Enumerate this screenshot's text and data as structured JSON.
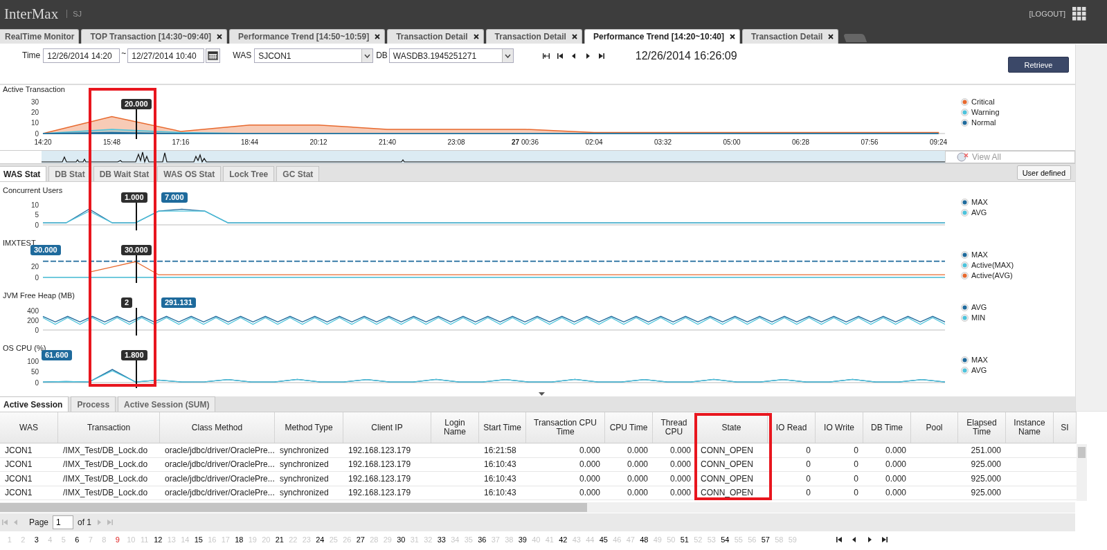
{
  "header": {
    "logo": "InterMax",
    "user": "SJ",
    "logout": "[LOGOUT]"
  },
  "tabs": [
    {
      "label": "RealTime Monitor",
      "selected": false,
      "closable": false
    },
    {
      "label": "TOP Transaction [14:30~09:40]",
      "selected": false,
      "closable": true
    },
    {
      "label": "Performance Trend [14:50~10:59]",
      "selected": false,
      "closable": true
    },
    {
      "label": "Transaction Detail",
      "selected": false,
      "closable": true
    },
    {
      "label": "Transaction Detail",
      "selected": false,
      "closable": true
    },
    {
      "label": "Performance Trend [14:20~10:40]",
      "selected": true,
      "closable": true
    },
    {
      "label": "Transaction Detail",
      "selected": false,
      "closable": true
    }
  ],
  "filter": {
    "time_label": "Time",
    "from": "12/26/2014 14:20",
    "separator": "~",
    "to": "12/27/2014 10:40",
    "was_label": "WAS",
    "was": "SJCON1",
    "db_label": "DB",
    "db": "WASDB3.1945251271",
    "current_time": "12/26/2014 16:26:09",
    "retrieve": "Retrieve"
  },
  "active_transaction": {
    "title": "Active Transaction",
    "tooltips": [
      {
        "text": "20.000",
        "kind": "cursor"
      }
    ],
    "chart_data": {
      "type": "area",
      "legend": "right",
      "ylim": [
        0,
        30
      ],
      "yticks": [
        0,
        10,
        20,
        30
      ],
      "categories": [
        "14:20",
        "15:48",
        "17:16",
        "18:44",
        "20:12",
        "21:40",
        "23:08",
        "**27** 00:36",
        "02:04",
        "03:32",
        "05:00",
        "06:28",
        "07:56",
        "09:24"
      ],
      "series": [
        {
          "name": "Critical",
          "color": "#e8692e",
          "values": [
            0,
            16,
            2,
            8,
            8,
            4,
            4,
            4,
            1,
            1,
            1,
            1,
            1,
            1
          ]
        },
        {
          "name": "Warning",
          "color": "#4cc3dc",
          "values": [
            0,
            4,
            1,
            0,
            0,
            0,
            0,
            0,
            0,
            0,
            0,
            0,
            0,
            0
          ]
        },
        {
          "name": "Normal",
          "color": "#1e6a9c",
          "values": [
            0,
            1,
            0,
            0,
            0,
            0,
            0,
            0,
            0,
            0,
            0,
            0,
            0,
            0
          ]
        }
      ]
    },
    "view_all": "View All"
  },
  "stat_tabs": [
    {
      "label": "WAS Stat",
      "selected": true
    },
    {
      "label": "DB Stat",
      "selected": false
    },
    {
      "label": "DB Wait Stat",
      "selected": false
    },
    {
      "label": "WAS OS Stat",
      "selected": false
    },
    {
      "label": "Lock Tree",
      "selected": false
    },
    {
      "label": "GC Stat",
      "selected": false
    }
  ],
  "user_defined": "User defined",
  "highlight_cursor": true,
  "charts": [
    {
      "title": "Concurrent Users",
      "tooltips": [
        {
          "text": "1.000",
          "kind": "cursor"
        },
        {
          "text": "7.000",
          "kind": "after"
        }
      ],
      "chart_data": {
        "type": "line",
        "legend": "right",
        "ylim": [
          0,
          12
        ],
        "yticks": [
          0,
          5,
          10
        ],
        "series": [
          {
            "name": "MAX",
            "color": "#1e6a9c",
            "values": [
              1,
              1,
              8,
              1,
              1,
              7,
              8,
              7,
              1,
              1,
              1,
              1,
              1,
              1,
              1,
              1,
              1,
              1,
              1,
              1,
              1,
              1,
              1,
              1,
              1,
              1,
              1,
              1,
              1,
              1,
              1,
              1,
              1,
              1,
              1,
              1,
              1,
              1,
              1,
              1
            ]
          },
          {
            "name": "AVG",
            "color": "#4cc3dc",
            "values": [
              1,
              1,
              7,
              1,
              1,
              7,
              7,
              7,
              1,
              1,
              1,
              1,
              1,
              1,
              1,
              1,
              1,
              1,
              1,
              1,
              1,
              1,
              1,
              1,
              1,
              1,
              1,
              1,
              1,
              1,
              1,
              1,
              1,
              1,
              1,
              1,
              1,
              1,
              1,
              1
            ]
          }
        ]
      }
    },
    {
      "title": "IMXTEST",
      "tooltips": [
        {
          "text": "30.000",
          "kind": "start"
        },
        {
          "text": "30.000",
          "kind": "cursor"
        }
      ],
      "chart_data": {
        "type": "line",
        "legend": "right",
        "ylim": [
          0,
          45
        ],
        "yticks": [
          0,
          20
        ],
        "series": [
          {
            "name": "MAX",
            "color": "#1e6a9c",
            "line_style": "dashed",
            "values": [
              31,
              31,
              31,
              31,
              31,
              31,
              31,
              31,
              31,
              31,
              31,
              31,
              31,
              31,
              31,
              31,
              31,
              31,
              31,
              31,
              31,
              31,
              31,
              31,
              31,
              31,
              31,
              31,
              31,
              31,
              31,
              31,
              31,
              31,
              31,
              31,
              31,
              31,
              31,
              31
            ]
          },
          {
            "name": "Active(MAX)",
            "color": "#4cc3dc",
            "values": [
              0,
              0,
              0,
              0,
              0,
              0,
              0,
              0,
              0,
              0,
              0,
              0,
              0,
              0,
              0,
              0,
              0,
              0,
              0,
              0,
              0,
              0,
              0,
              0,
              0,
              0,
              0,
              0,
              0,
              0,
              0,
              0,
              0,
              0,
              0,
              0,
              0,
              0,
              0,
              0
            ]
          },
          {
            "name": "Active(AVG)",
            "color": "#e8692e",
            "values": [
              null,
              null,
              10,
              20,
              30,
              5,
              5,
              5,
              5,
              5,
              5,
              5,
              5,
              5,
              5,
              5,
              5,
              5,
              5,
              5,
              5,
              5,
              5,
              5,
              5,
              5,
              5,
              5,
              5,
              5,
              5,
              5,
              5,
              5,
              5,
              5,
              5,
              5,
              5,
              5
            ]
          }
        ]
      }
    },
    {
      "title": "JVM Free Heap (MB)",
      "tooltips": [
        {
          "text": "2",
          "kind": "cursor"
        },
        {
          "text": "291.131",
          "kind": "after"
        }
      ],
      "chart_data": {
        "type": "line",
        "legend": "right",
        "ylim": [
          0,
          500
        ],
        "yticks": [
          0,
          200,
          400
        ],
        "series": [
          {
            "name": "AVG",
            "color": "#1e6a9c",
            "values": [
              290,
              170,
              290,
              170,
              290,
              170,
              290,
              170,
              290,
              170,
              290,
              170,
              290,
              170,
              290,
              170,
              290,
              170,
              290,
              170,
              290,
              170,
              290,
              170,
              290,
              170,
              290,
              170,
              290,
              170,
              290,
              170,
              290,
              170,
              290,
              170,
              290,
              170,
              290,
              170,
              290,
              170,
              290,
              170,
              290,
              170,
              290,
              170,
              290,
              170,
              290,
              170,
              290,
              170,
              290,
              170,
              290,
              170,
              290,
              170,
              290,
              170,
              290,
              170,
              290,
              170,
              290,
              170,
              290,
              170,
              290,
              170,
              290,
              170
            ]
          },
          {
            "name": "MIN",
            "color": "#4cc3dc",
            "values": [
              260,
              120,
              260,
              120,
              260,
              120,
              260,
              120,
              260,
              120,
              260,
              120,
              260,
              120,
              260,
              120,
              260,
              120,
              260,
              120,
              260,
              120,
              260,
              120,
              260,
              120,
              260,
              120,
              260,
              120,
              260,
              120,
              260,
              120,
              260,
              120,
              260,
              120,
              260,
              120,
              260,
              120,
              260,
              120,
              260,
              120,
              260,
              120,
              260,
              120,
              260,
              120,
              260,
              120,
              260,
              120,
              260,
              120,
              260,
              120,
              260,
              120,
              260,
              120,
              260,
              120,
              260,
              120,
              260,
              120,
              260,
              120,
              260,
              120
            ]
          }
        ]
      }
    },
    {
      "title": "OS CPU (%)",
      "tooltips": [
        {
          "text": "61.600",
          "kind": "before"
        },
        {
          "text": "1.800",
          "kind": "cursor"
        }
      ],
      "chart_data": {
        "type": "line",
        "legend": "right",
        "ylim": [
          0,
          110
        ],
        "yticks": [
          0,
          50,
          100
        ],
        "series": [
          {
            "name": "MAX",
            "color": "#1e6a9c",
            "values": [
              3,
              5,
              3,
              61,
              3,
              12,
              3,
              4,
              14,
              3,
              3,
              15,
              3,
              3,
              14,
              3,
              3,
              15,
              3,
              3,
              14,
              3,
              3,
              15,
              3,
              3,
              14,
              3,
              3,
              15,
              3,
              3,
              14,
              3,
              3,
              15,
              3,
              3,
              14,
              3
            ]
          },
          {
            "name": "AVG",
            "color": "#4cc3dc",
            "values": [
              3,
              5,
              3,
              55,
              3,
              12,
              3,
              4,
              14,
              3,
              3,
              15,
              3,
              3,
              14,
              3,
              3,
              15,
              3,
              3,
              14,
              3,
              3,
              15,
              3,
              3,
              14,
              3,
              3,
              15,
              3,
              3,
              14,
              3,
              3,
              15,
              3,
              3,
              14,
              3
            ]
          }
        ]
      }
    }
  ],
  "session_tabs": [
    {
      "label": "Active Session",
      "selected": true
    },
    {
      "label": "Process",
      "selected": false
    },
    {
      "label": "Active Session (SUM)",
      "selected": false
    }
  ],
  "table": {
    "columns": [
      {
        "label": "WAS",
        "kind": "text"
      },
      {
        "label": "Transaction",
        "kind": "text"
      },
      {
        "label": "Class Method",
        "kind": "text"
      },
      {
        "label": "Method Type",
        "kind": "text"
      },
      {
        "label": "Client IP",
        "kind": "text"
      },
      {
        "label": "Login Name"
      },
      {
        "label": "Start Time",
        "kind": "text"
      },
      {
        "label": "Transaction CPU Time",
        "kind": "number"
      },
      {
        "label": "CPU Time",
        "kind": "number"
      },
      {
        "label": "Thread CPU",
        "kind": "number"
      },
      {
        "label": "State",
        "kind": "text",
        "highlighted": true
      },
      {
        "label": "IO Read",
        "kind": "number"
      },
      {
        "label": "IO Write",
        "kind": "number"
      },
      {
        "label": "DB Time",
        "kind": "number"
      },
      {
        "label": "Pool"
      },
      {
        "label": "Elapsed Time",
        "kind": "number"
      },
      {
        "label": "Instance Name"
      },
      {
        "label": "SI"
      }
    ],
    "rows": [
      [
        "JCON1",
        "/IMX_Test/DB_Lock.do",
        "oracle/jdbc/driver/OraclePre...",
        "synchronized",
        "192.168.123.179",
        null,
        "16:21:58",
        "0.000",
        "0.000",
        "0.000",
        "CONN_OPEN",
        "0",
        "0",
        "0.000",
        null,
        "251.000",
        null,
        null
      ],
      [
        "JCON1",
        "/IMX_Test/DB_Lock.do",
        "oracle/jdbc/driver/OraclePre...",
        "synchronized",
        "192.168.123.179",
        null,
        "16:10:43",
        "0.000",
        "0.000",
        "0.000",
        "CONN_OPEN",
        "0",
        "0",
        "0.000",
        null,
        "925.000",
        null,
        null
      ],
      [
        "JCON1",
        "/IMX_Test/DB_Lock.do",
        "oracle/jdbc/driver/OraclePre...",
        "synchronized",
        "192.168.123.179",
        null,
        "16:10:43",
        "0.000",
        "0.000",
        "0.000",
        "CONN_OPEN",
        "0",
        "0",
        "0.000",
        null,
        "925.000",
        null,
        null
      ],
      [
        "JCON1",
        "/IMX_Test/DB_Lock.do",
        "oracle/jdbc/driver/OraclePre...",
        "synchronized",
        "192.168.123.179",
        null,
        "16:10:43",
        "0.000",
        "0.000",
        "0.000",
        "CONN_OPEN",
        "0",
        "0",
        "0.000",
        null,
        "925.000",
        null,
        null
      ]
    ]
  },
  "pager": {
    "page_label": "Page",
    "page": "1",
    "of": "of 1"
  },
  "days": [
    {
      "label": "1",
      "kind": "off"
    },
    {
      "label": "2",
      "kind": "off"
    },
    {
      "label": "3",
      "kind": "on"
    },
    {
      "label": "4",
      "kind": "off"
    },
    {
      "label": "5",
      "kind": "off"
    },
    {
      "label": "6",
      "kind": "on"
    },
    {
      "label": "7",
      "kind": "off"
    },
    {
      "label": "8",
      "kind": "off"
    },
    {
      "label": "9",
      "kind": "current"
    },
    {
      "label": "10",
      "kind": "off"
    },
    {
      "label": "11",
      "kind": "off"
    },
    {
      "label": "12",
      "kind": "on"
    },
    {
      "label": "13",
      "kind": "off"
    },
    {
      "label": "14",
      "kind": "off"
    },
    {
      "label": "15",
      "kind": "on"
    },
    {
      "label": "16",
      "kind": "off"
    },
    {
      "label": "17",
      "kind": "off"
    },
    {
      "label": "18",
      "kind": "on"
    },
    {
      "label": "19",
      "kind": "off"
    },
    {
      "label": "20",
      "kind": "off"
    },
    {
      "label": "21",
      "kind": "on"
    },
    {
      "label": "22",
      "kind": "off"
    },
    {
      "label": "23",
      "kind": "off"
    },
    {
      "label": "24",
      "kind": "on"
    },
    {
      "label": "25",
      "kind": "off"
    },
    {
      "label": "26",
      "kind": "off"
    },
    {
      "label": "27",
      "kind": "on"
    },
    {
      "label": "28",
      "kind": "off"
    },
    {
      "label": "29",
      "kind": "off"
    },
    {
      "label": "30",
      "kind": "on"
    },
    {
      "label": "31",
      "kind": "off"
    },
    {
      "label": "32",
      "kind": "off"
    },
    {
      "label": "33",
      "kind": "on"
    },
    {
      "label": "34",
      "kind": "off"
    },
    {
      "label": "35",
      "kind": "off"
    },
    {
      "label": "36",
      "kind": "on"
    },
    {
      "label": "37",
      "kind": "off"
    },
    {
      "label": "38",
      "kind": "off"
    },
    {
      "label": "39",
      "kind": "on"
    },
    {
      "label": "40",
      "kind": "off"
    },
    {
      "label": "41",
      "kind": "off"
    },
    {
      "label": "42",
      "kind": "on"
    },
    {
      "label": "43",
      "kind": "off"
    },
    {
      "label": "44",
      "kind": "off"
    },
    {
      "label": "45",
      "kind": "on"
    },
    {
      "label": "46",
      "kind": "off"
    },
    {
      "label": "47",
      "kind": "off"
    },
    {
      "label": "48",
      "kind": "on"
    },
    {
      "label": "49",
      "kind": "off"
    },
    {
      "label": "50",
      "kind": "off"
    },
    {
      "label": "51",
      "kind": "on"
    },
    {
      "label": "52",
      "kind": "off"
    },
    {
      "label": "53",
      "kind": "off"
    },
    {
      "label": "54",
      "kind": "on"
    },
    {
      "label": "55",
      "kind": "off"
    },
    {
      "label": "56",
      "kind": "off"
    },
    {
      "label": "57",
      "kind": "on"
    },
    {
      "label": "58",
      "kind": "off"
    },
    {
      "label": "59",
      "kind": "off"
    }
  ]
}
